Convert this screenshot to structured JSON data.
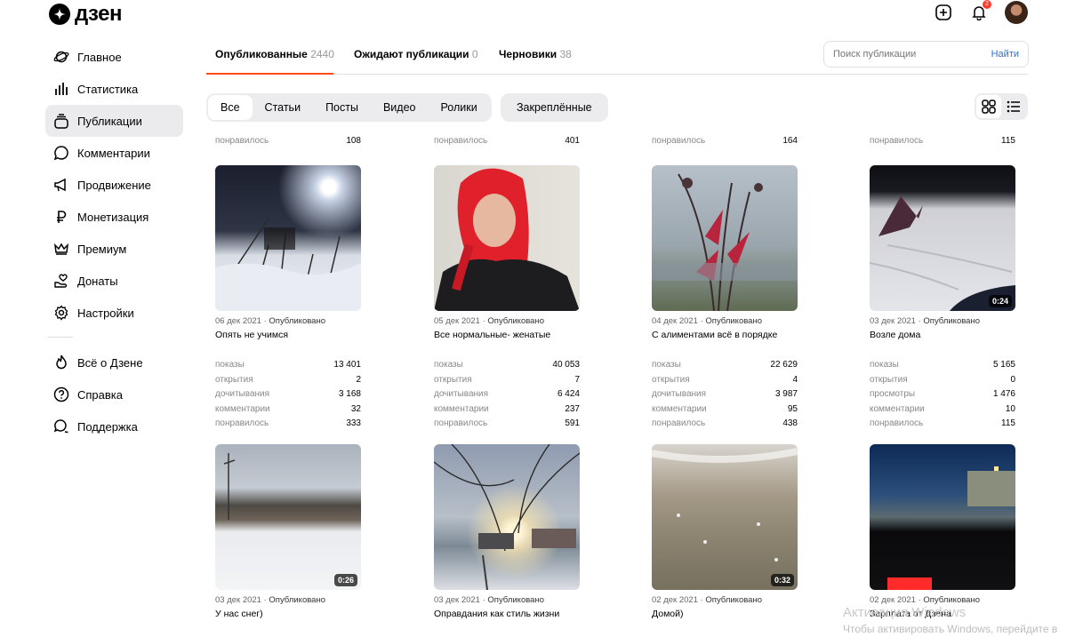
{
  "app": {
    "logo_text": "дзен"
  },
  "header": {
    "notifications_count": "2"
  },
  "sidebar": {
    "items": [
      {
        "label": "Главное",
        "icon": "planet-icon"
      },
      {
        "label": "Статистика",
        "icon": "bar-chart-icon"
      },
      {
        "label": "Публикации",
        "icon": "stack-icon",
        "active": true
      },
      {
        "label": "Комментарии",
        "icon": "comment-icon"
      },
      {
        "label": "Продвижение",
        "icon": "megaphone-icon"
      },
      {
        "label": "Монетизация",
        "icon": "ruble-icon"
      },
      {
        "label": "Премиум",
        "icon": "crown-icon"
      },
      {
        "label": "Донаты",
        "icon": "donation-icon"
      },
      {
        "label": "Настройки",
        "icon": "gear-icon"
      }
    ],
    "secondary": [
      {
        "label": "Всё о Дзене",
        "icon": "flame-icon"
      },
      {
        "label": "Справка",
        "icon": "help-icon"
      },
      {
        "label": "Поддержка",
        "icon": "support-chat-icon"
      }
    ]
  },
  "tabs": [
    {
      "label": "Опубликованные",
      "count": "2440"
    },
    {
      "label": "Ожидают публикации",
      "count": "0"
    },
    {
      "label": "Черновики",
      "count": "38"
    }
  ],
  "search": {
    "placeholder": "Поиск публикации",
    "button": "Найти"
  },
  "filters": [
    "Все",
    "Статьи",
    "Посты",
    "Видео",
    "Ролики"
  ],
  "pinned_label": "Закреплённые",
  "previous_row": [
    {
      "key": "понравилось",
      "value": "108"
    },
    {
      "key": "понравилось",
      "value": "401"
    },
    {
      "key": "понравилось",
      "value": "164"
    },
    {
      "key": "понравилось",
      "value": "115"
    }
  ],
  "cards": [
    {
      "date": "06 дек 2021",
      "status": "Опубликовано",
      "title": "Опять не учимся",
      "duration": "",
      "stats": [
        [
          "показы",
          "13 401"
        ],
        [
          "открытия",
          "2"
        ],
        [
          "дочитывания",
          "3 168"
        ],
        [
          "комментарии",
          "32"
        ],
        [
          "понравилось",
          "333"
        ]
      ]
    },
    {
      "date": "05 дек 2021",
      "status": "Опубликовано",
      "title": "Все нормальные- женатые",
      "duration": "",
      "stats": [
        [
          "показы",
          "40 053"
        ],
        [
          "открытия",
          "7"
        ],
        [
          "дочитывания",
          "6 424"
        ],
        [
          "комментарии",
          "237"
        ],
        [
          "понравилось",
          "591"
        ]
      ]
    },
    {
      "date": "04 дек 2021",
      "status": "Опубликовано",
      "title": "С алиментами всё в порядке",
      "duration": "",
      "stats": [
        [
          "показы",
          "22 629"
        ],
        [
          "открытия",
          "4"
        ],
        [
          "дочитывания",
          "3 987"
        ],
        [
          "комментарии",
          "95"
        ],
        [
          "понравилось",
          "438"
        ]
      ]
    },
    {
      "date": "03 дек 2021",
      "status": "Опубликовано",
      "title": "Возле дома",
      "duration": "0:24",
      "stats": [
        [
          "показы",
          "5 165"
        ],
        [
          "открытия",
          "0"
        ],
        [
          "просмотры",
          "1 476"
        ],
        [
          "комментарии",
          "10"
        ],
        [
          "понравилось",
          "115"
        ]
      ]
    },
    {
      "date": "03 дек 2021",
      "status": "Опубликовано",
      "title": "У нас снег)",
      "duration": "0:26",
      "stats": []
    },
    {
      "date": "03 дек 2021",
      "status": "Опубликовано",
      "title": "Оправдания как стиль жизни",
      "duration": "",
      "stats": []
    },
    {
      "date": "02 дек 2021",
      "status": "Опубликовано",
      "title": "Домой)",
      "duration": "0:32",
      "stats": []
    },
    {
      "date": "02 дек 2021",
      "status": "Опубликовано",
      "title": "Зарплата от Дзена",
      "duration": "",
      "stats": []
    }
  ],
  "watermark": {
    "line1": "Активация Windows",
    "line2": "Чтобы активировать Windows, перейдите в"
  }
}
